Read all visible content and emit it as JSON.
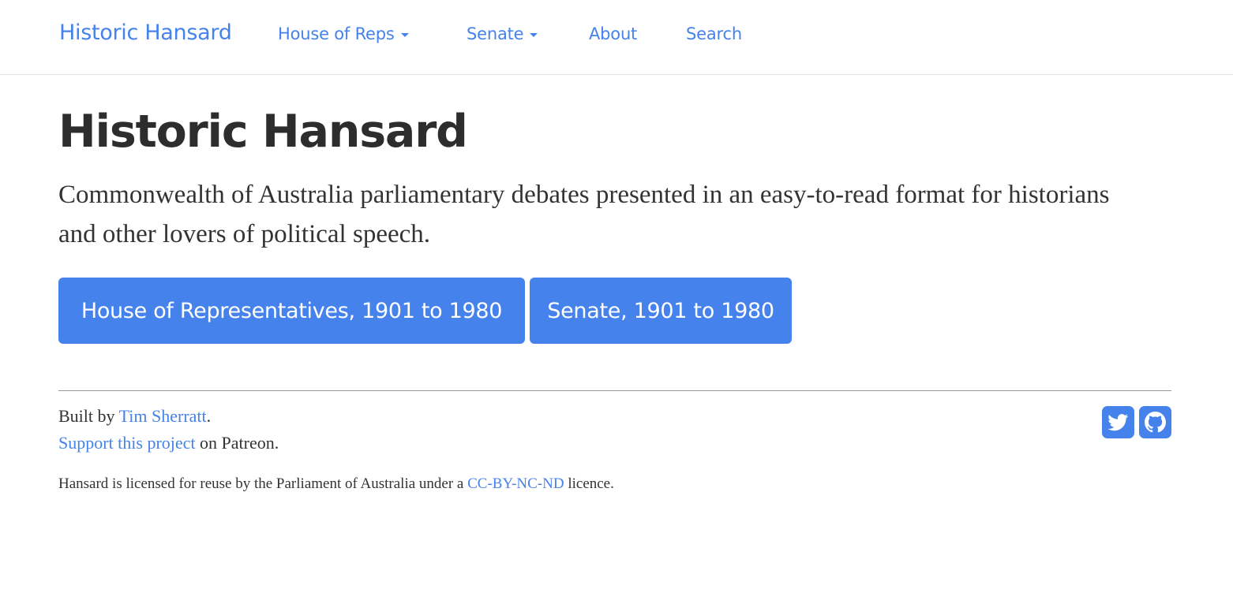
{
  "navbar": {
    "brand": "Historic Hansard",
    "items": [
      {
        "label": "House of Reps",
        "dropdown": true
      },
      {
        "label": "Senate",
        "dropdown": true
      },
      {
        "label": "About",
        "dropdown": false
      },
      {
        "label": "Search",
        "dropdown": false
      }
    ]
  },
  "main": {
    "title": "Historic Hansard",
    "lead": "Commonwealth of Australia parliamentary debates presented in an easy-to-read format for historians and other lovers of political speech.",
    "buttons": [
      {
        "label": "House of Representatives, 1901 to 1980"
      },
      {
        "label": "Senate, 1901 to 1980"
      }
    ]
  },
  "footer": {
    "built_prefix": "Built by ",
    "author_link": "Tim Sherratt",
    "built_suffix": ".",
    "support_link": "Support this project",
    "support_suffix": " on Patreon.",
    "licence_prefix": "Hansard is licensed for reuse by the Parliament of Australia under a ",
    "licence_link": "CC-BY-NC-ND",
    "licence_suffix": " licence.",
    "social": [
      {
        "icon": "twitter-icon"
      },
      {
        "icon": "github-icon"
      }
    ]
  },
  "colors": {
    "accent": "#4582ec",
    "text": "#333333",
    "heading": "#2d2d2d"
  }
}
